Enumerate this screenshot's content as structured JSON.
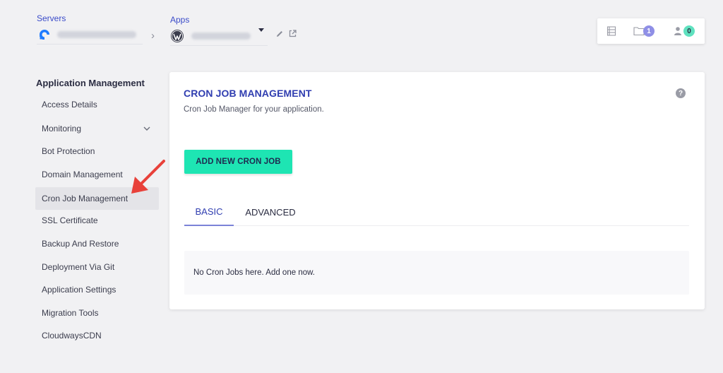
{
  "breadcrumb": {
    "servers_label": "Servers",
    "apps_label": "Apps"
  },
  "topbar": {
    "projects_count": "1",
    "team_count": "0"
  },
  "sidebar": {
    "heading": "Application Management",
    "items": [
      {
        "label": "Access Details"
      },
      {
        "label": "Monitoring"
      },
      {
        "label": "Bot Protection"
      },
      {
        "label": "Domain Management"
      },
      {
        "label": "Cron Job Management"
      },
      {
        "label": "SSL Certificate"
      },
      {
        "label": "Backup And Restore"
      },
      {
        "label": "Deployment Via Git"
      },
      {
        "label": "Application Settings"
      },
      {
        "label": "Migration Tools"
      },
      {
        "label": "CloudwaysCDN"
      }
    ],
    "active_index": 4
  },
  "main": {
    "title": "CRON JOB MANAGEMENT",
    "subtitle": "Cron Job Manager for your application.",
    "help_label": "?",
    "add_button_label": "ADD NEW CRON JOB",
    "tabs": [
      {
        "label": "BASIC"
      },
      {
        "label": "ADVANCED"
      }
    ],
    "empty_message": "No Cron Jobs here. Add one now."
  },
  "colors": {
    "accent_blue": "#2f3db0",
    "button_green": "#1ee5b3",
    "annotation_red": "#e8413a"
  }
}
